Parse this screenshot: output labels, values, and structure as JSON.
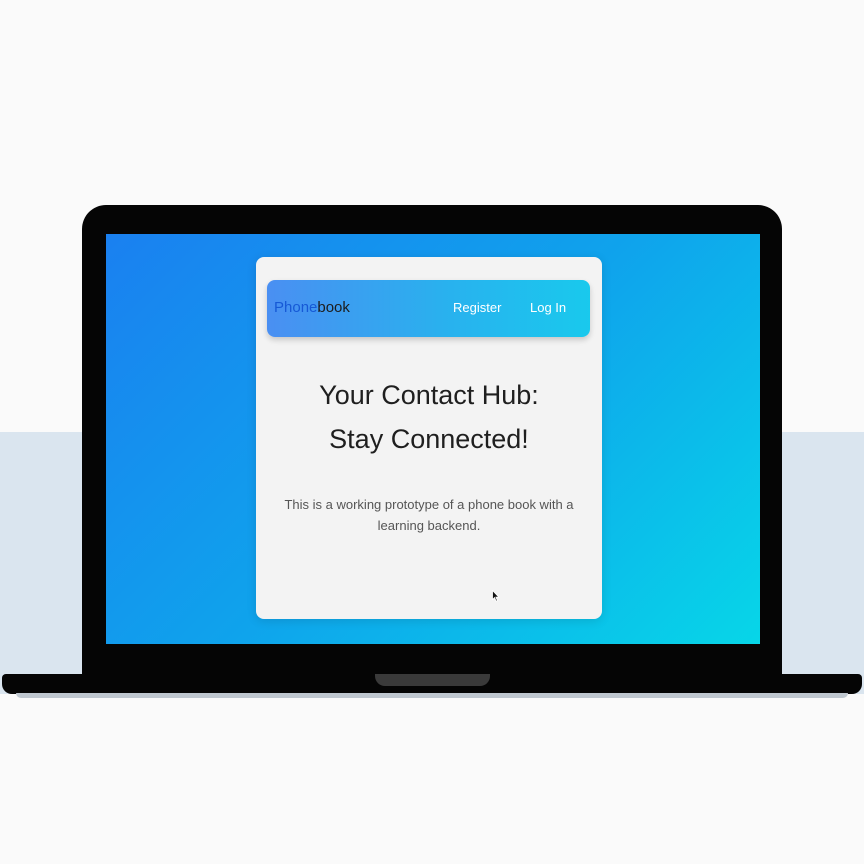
{
  "app": {
    "brand_part1": "Phone",
    "brand_part2": "book"
  },
  "nav": {
    "register_label": "Register",
    "login_label": "Log In"
  },
  "hero": {
    "title_line1": "Your Contact Hub:",
    "title_line2": "Stay Connected!",
    "description": "This is a working prototype of a phone book with a learning backend."
  },
  "colors": {
    "brand_blue": "#1659d6",
    "screen_gradient_start": "#1a80f0",
    "screen_gradient_end": "#07d6e8"
  },
  "icons": {
    "pointer": "mouse-pointer-icon"
  }
}
